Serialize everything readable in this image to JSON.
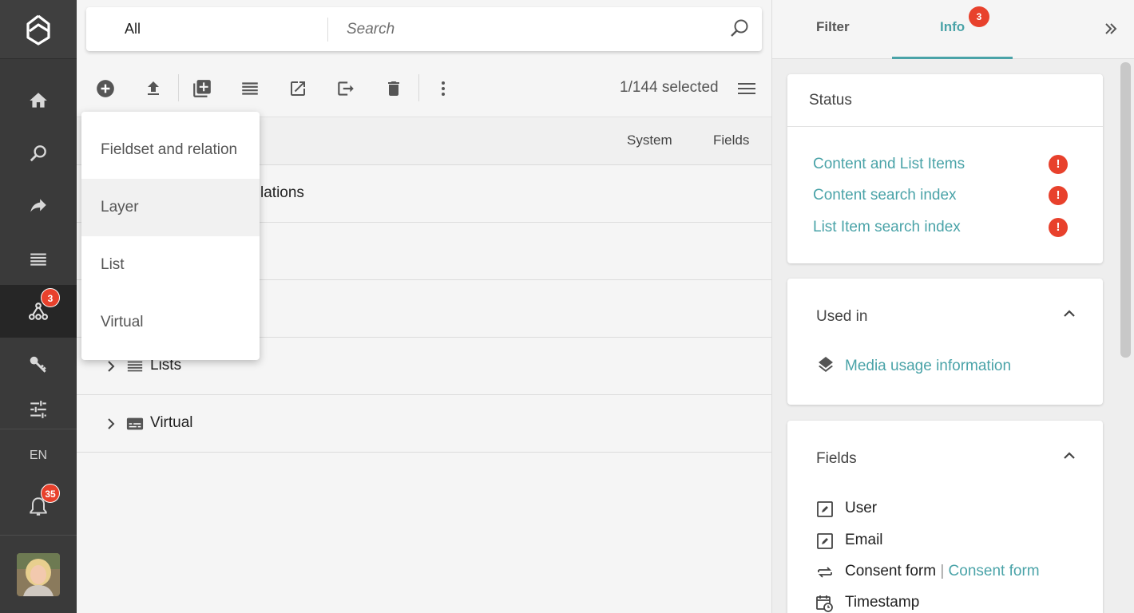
{
  "search": {
    "scope": "All",
    "placeholder": "Search"
  },
  "nav": {
    "logo_icon": "picturepark-logo",
    "items": [
      {
        "icon": "home-icon"
      },
      {
        "icon": "search-icon"
      },
      {
        "icon": "share-icon"
      },
      {
        "icon": "list-icon"
      },
      {
        "icon": "schema-tree-icon",
        "badge": "3"
      },
      {
        "icon": "key-icon"
      },
      {
        "icon": "settings-sliders-icon"
      }
    ],
    "language": "EN",
    "notifications_badge": "35"
  },
  "toolbar": {
    "selected_text": "1/144 selected"
  },
  "table": {
    "columns": [
      "System",
      "Fields"
    ],
    "rows": [
      {
        "label": "lations"
      },
      {
        "label": ""
      },
      {
        "label": ""
      },
      {
        "label": "Lists"
      },
      {
        "label": "Virtual"
      }
    ]
  },
  "dropdown": {
    "items": [
      "Fieldset and relation",
      "Layer",
      "List",
      "Virtual"
    ]
  },
  "right_panel": {
    "tabs": [
      "Filter",
      "Info"
    ],
    "info_badge": "3",
    "status": {
      "title": "Status",
      "items": [
        "Content and List Items",
        "Content search index",
        "List Item search index"
      ],
      "error_mark": "!"
    },
    "used_in": {
      "title": "Used in",
      "link": "Media usage information"
    },
    "fields": {
      "title": "Fields",
      "items": [
        {
          "icon": "edit-box-icon",
          "text": "User"
        },
        {
          "icon": "edit-box-icon",
          "text": "Email"
        },
        {
          "icon": "relation-arrows-icon",
          "text": "Consent form",
          "sep": " | ",
          "link": "Consent form"
        },
        {
          "icon": "calendar-clock-icon",
          "text": "Timestamp"
        }
      ]
    }
  },
  "colors": {
    "accent": "#4aa3a8",
    "badge": "#e8412c",
    "nav_bg": "#3a3a3a"
  }
}
